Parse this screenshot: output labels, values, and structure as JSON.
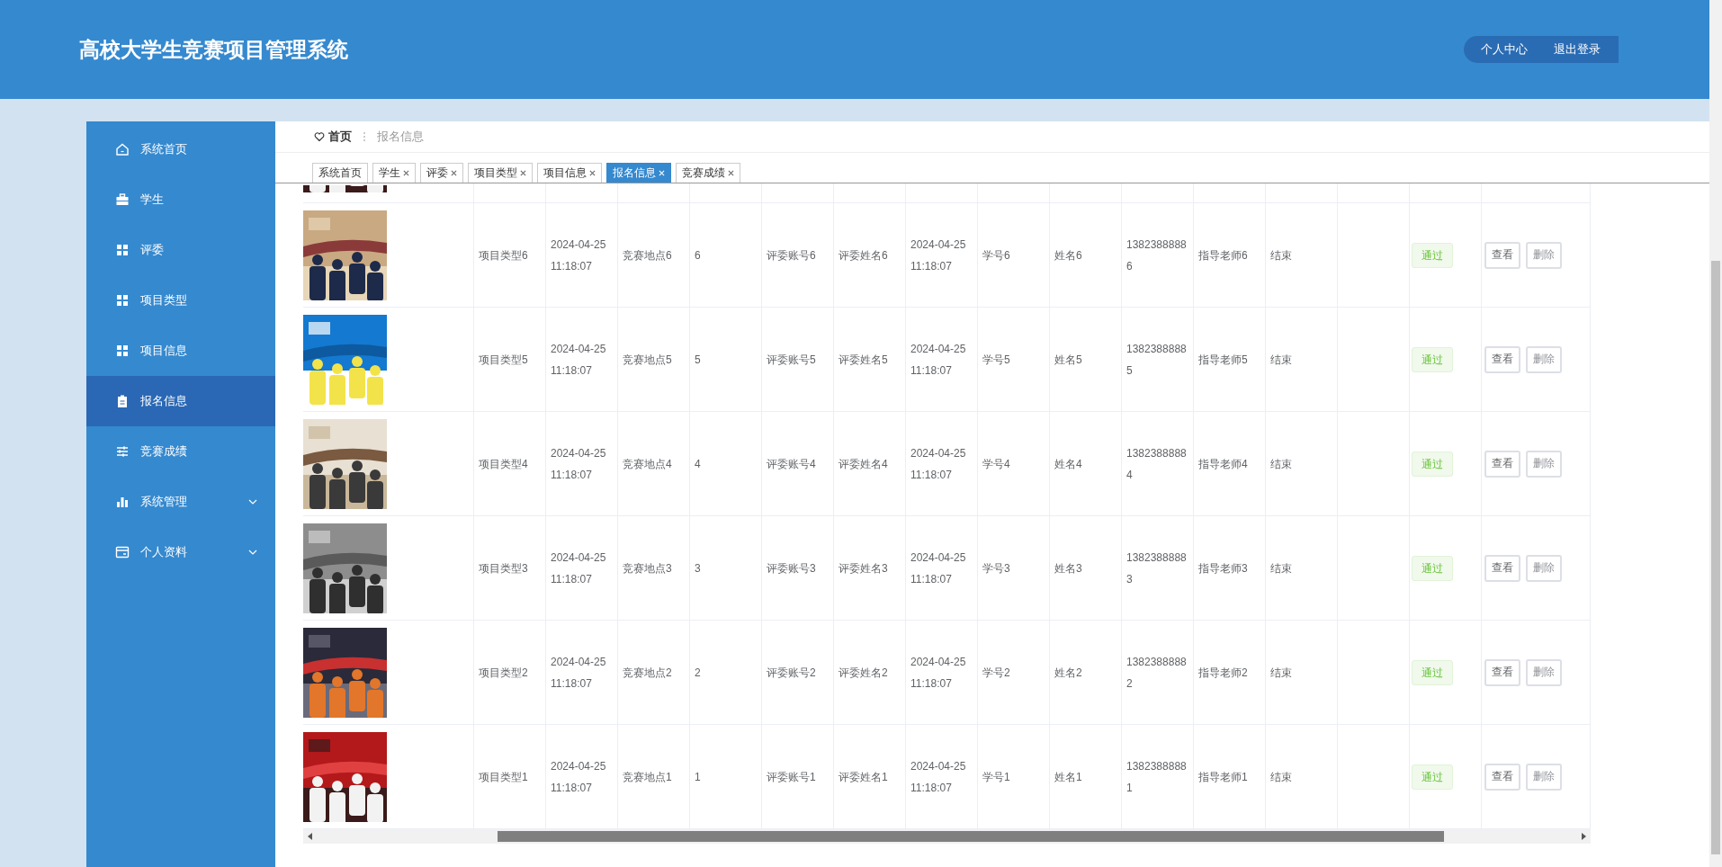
{
  "header": {
    "title": "高校大学生竞赛项目管理系统",
    "links": [
      "个人中心",
      "退出登录"
    ]
  },
  "sidebar": {
    "items": [
      {
        "label": "系统首页",
        "kind": "link",
        "selected": false
      },
      {
        "label": "学生",
        "kind": "link",
        "selected": false
      },
      {
        "label": "评委",
        "kind": "link",
        "selected": false
      },
      {
        "label": "项目类型",
        "kind": "link",
        "selected": false
      },
      {
        "label": "项目信息",
        "kind": "link",
        "selected": false
      },
      {
        "label": "报名信息",
        "kind": "link",
        "selected": true
      },
      {
        "label": "竞赛成绩",
        "kind": "link",
        "selected": false
      },
      {
        "label": "系统管理",
        "kind": "submenu",
        "selected": false
      },
      {
        "label": "个人资料",
        "kind": "submenu",
        "selected": false
      }
    ]
  },
  "breadcrumb": {
    "home": "首页",
    "current": "报名信息"
  },
  "tabs": [
    {
      "label": "系统首页",
      "closable": false,
      "selected": false
    },
    {
      "label": "学生",
      "closable": true,
      "selected": false
    },
    {
      "label": "评委",
      "closable": true,
      "selected": false
    },
    {
      "label": "项目类型",
      "closable": true,
      "selected": false
    },
    {
      "label": "项目信息",
      "closable": true,
      "selected": false
    },
    {
      "label": "报名信息",
      "closable": true,
      "selected": true
    },
    {
      "label": "竞赛成绩",
      "closable": true,
      "selected": false
    }
  ],
  "table": {
    "rows": [
      {
        "cells": [
          "项目类型6",
          "2024-04-25 11:18:07",
          "竞赛地点6",
          "6",
          "评委账号6",
          "评委姓名6",
          "2024-04-25 11:18:07",
          "学号6",
          "姓名6",
          "13823888886",
          "指导老师6",
          "结束"
        ],
        "status": {
          "text": "通过",
          "kind": "success"
        },
        "actions": [
          "查看",
          "删除"
        ]
      },
      {
        "cells": [
          "项目类型5",
          "2024-04-25 11:18:07",
          "竞赛地点5",
          "5",
          "评委账号5",
          "评委姓名5",
          "2024-04-25 11:18:07",
          "学号5",
          "姓名5",
          "13823888885",
          "指导老师5",
          "结束"
        ],
        "status": {
          "text": "通过",
          "kind": "success"
        },
        "actions": [
          "查看",
          "删除"
        ]
      },
      {
        "cells": [
          "项目类型4",
          "2024-04-25 11:18:07",
          "竞赛地点4",
          "4",
          "评委账号4",
          "评委姓名4",
          "2024-04-25 11:18:07",
          "学号4",
          "姓名4",
          "13823888884",
          "指导老师4",
          "结束"
        ],
        "status": {
          "text": "通过",
          "kind": "success"
        },
        "actions": [
          "查看",
          "删除"
        ]
      },
      {
        "cells": [
          "项目类型3",
          "2024-04-25 11:18:07",
          "竞赛地点3",
          "3",
          "评委账号3",
          "评委姓名3",
          "2024-04-25 11:18:07",
          "学号3",
          "姓名3",
          "13823888883",
          "指导老师3",
          "结束"
        ],
        "status": {
          "text": "通过",
          "kind": "success"
        },
        "actions": [
          "查看",
          "删除"
        ]
      },
      {
        "cells": [
          "项目类型2",
          "2024-04-25 11:18:07",
          "竞赛地点2",
          "2",
          "评委账号2",
          "评委姓名2",
          "2024-04-25 11:18:07",
          "学号2",
          "姓名2",
          "13823888882",
          "指导老师2",
          "结束"
        ],
        "status": {
          "text": "通过",
          "kind": "success"
        },
        "actions": [
          "查看",
          "删除"
        ]
      },
      {
        "cells": [
          "项目类型1",
          "2024-04-25 11:18:07",
          "竞赛地点1",
          "1",
          "评委账号1",
          "评委姓名1",
          "2024-04-25 11:18:07",
          "学号1",
          "姓名1",
          "13823888881",
          "指导老师1",
          "结束"
        ],
        "status": {
          "text": "通过",
          "kind": "success"
        },
        "actions": [
          "查看",
          "删除"
        ]
      }
    ]
  }
}
